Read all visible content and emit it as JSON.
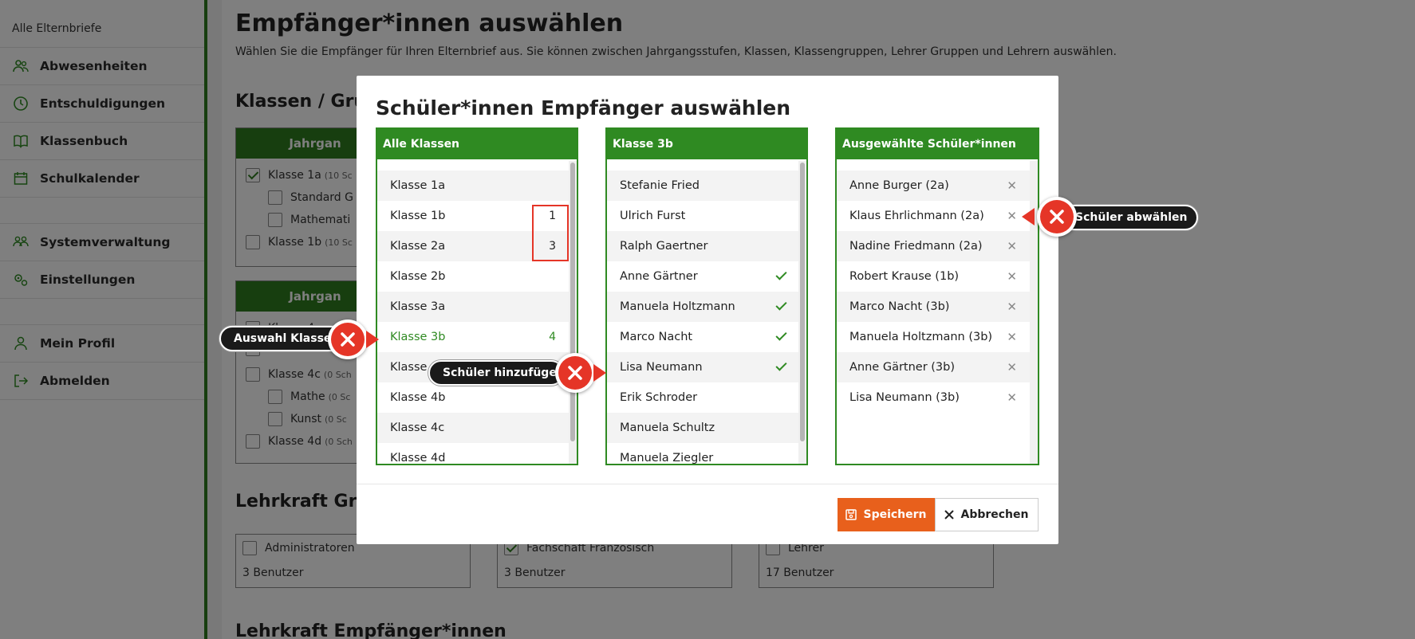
{
  "sidebar": {
    "top": "Alle Elternbriefe",
    "items": [
      {
        "label": "Abwesenheiten"
      },
      {
        "label": "Entschuldigungen"
      },
      {
        "label": "Klassenbuch"
      },
      {
        "label": "Schulkalender"
      },
      {
        "label": "Systemverwaltung"
      },
      {
        "label": "Einstellungen"
      },
      {
        "label": "Mein Profil"
      },
      {
        "label": "Abmelden"
      }
    ]
  },
  "page": {
    "title": "Empfänger*innen auswählen",
    "subtitle": "Wählen Sie die Empfänger für Ihren Elternbrief aus. Sie können zwischen Jahrgangsstufen, Klassen, Klassengruppen, Lehrer Gruppen und Lehrern auswählen.",
    "section_classes": "Klassen / Gru",
    "card1": {
      "header": "Jahrgan",
      "rows": [
        {
          "label": "Klasse 1a",
          "count": "(10 Sc"
        },
        {
          "label": "Standard G",
          "count": ""
        },
        {
          "label": "Mathemati",
          "count": ""
        },
        {
          "label": "Klasse 1b",
          "count": "(10 Sc"
        }
      ]
    },
    "card2": {
      "header": "Jahrgan",
      "rows": [
        {
          "label": "Klasse 4a",
          "count": ""
        },
        {
          "label": "Klasse 4b",
          "count": ""
        },
        {
          "label": "Klasse 4c",
          "count": "(0 Sch"
        },
        {
          "label": "Mathe",
          "count": "(0 Sc"
        },
        {
          "label": "Kunst",
          "count": "(0 Sc"
        },
        {
          "label": "Klasse 4d",
          "count": "(0 Sch"
        }
      ]
    },
    "section_teachers": "Lehrkraft Gru",
    "groups": [
      {
        "label": "Administratoren",
        "count": "3 Benutzer"
      },
      {
        "label": "Fachschaft Französisch",
        "count": "3 Benutzer"
      },
      {
        "label": "Lehrer",
        "count": "17 Benutzer"
      }
    ],
    "section_teacher_recipients": "Lehrkraft Empfänger*innen"
  },
  "modal": {
    "title": "Schüler*innen Empfänger auswählen",
    "classes_header": "Alle Klassen",
    "classes": [
      {
        "label": "Klasse 1a",
        "count": ""
      },
      {
        "label": "Klasse 1b",
        "count": "1"
      },
      {
        "label": "Klasse 2a",
        "count": "3"
      },
      {
        "label": "Klasse 2b",
        "count": ""
      },
      {
        "label": "Klasse 3a",
        "count": ""
      },
      {
        "label": "Klasse 3b",
        "count": "4"
      },
      {
        "label": "Klasse 4a",
        "count": ""
      },
      {
        "label": "Klasse 4b",
        "count": ""
      },
      {
        "label": "Klasse 4c",
        "count": ""
      },
      {
        "label": "Klasse 4d",
        "count": ""
      }
    ],
    "students_header": "Klasse 3b",
    "students": [
      {
        "label": "Stefanie Fried"
      },
      {
        "label": "Ulrich Furst"
      },
      {
        "label": "Ralph Gaertner"
      },
      {
        "label": "Anne Gärtner"
      },
      {
        "label": "Manuela Holtzmann"
      },
      {
        "label": "Marco Nacht"
      },
      {
        "label": "Lisa Neumann"
      },
      {
        "label": "Erik Schroder"
      },
      {
        "label": "Manuela Schultz"
      },
      {
        "label": "Manuela Ziegler"
      }
    ],
    "selected_header": "Ausgewählte Schüler*innen",
    "selected": [
      {
        "label": "Anne Burger (2a)"
      },
      {
        "label": "Klaus Ehrlichmann (2a)"
      },
      {
        "label": "Nadine Friedmann (2a)"
      },
      {
        "label": "Robert Krause (1b)"
      },
      {
        "label": "Marco Nacht (3b)"
      },
      {
        "label": "Manuela Holtzmann (3b)"
      },
      {
        "label": "Anne Gärtner (3b)"
      },
      {
        "label": "Lisa Neumann (3b)"
      }
    ],
    "save_label": "Speichern",
    "cancel_label": "Abbrechen"
  },
  "annotations": {
    "select_class": "Auswahl Klasse",
    "add_student": "Schüler hinzufügen",
    "remove_student": "Schüler abwählen"
  },
  "colors": {
    "brand_green": "#2f8a22",
    "accent_orange": "#e8601c",
    "marker_red": "#e53527"
  }
}
